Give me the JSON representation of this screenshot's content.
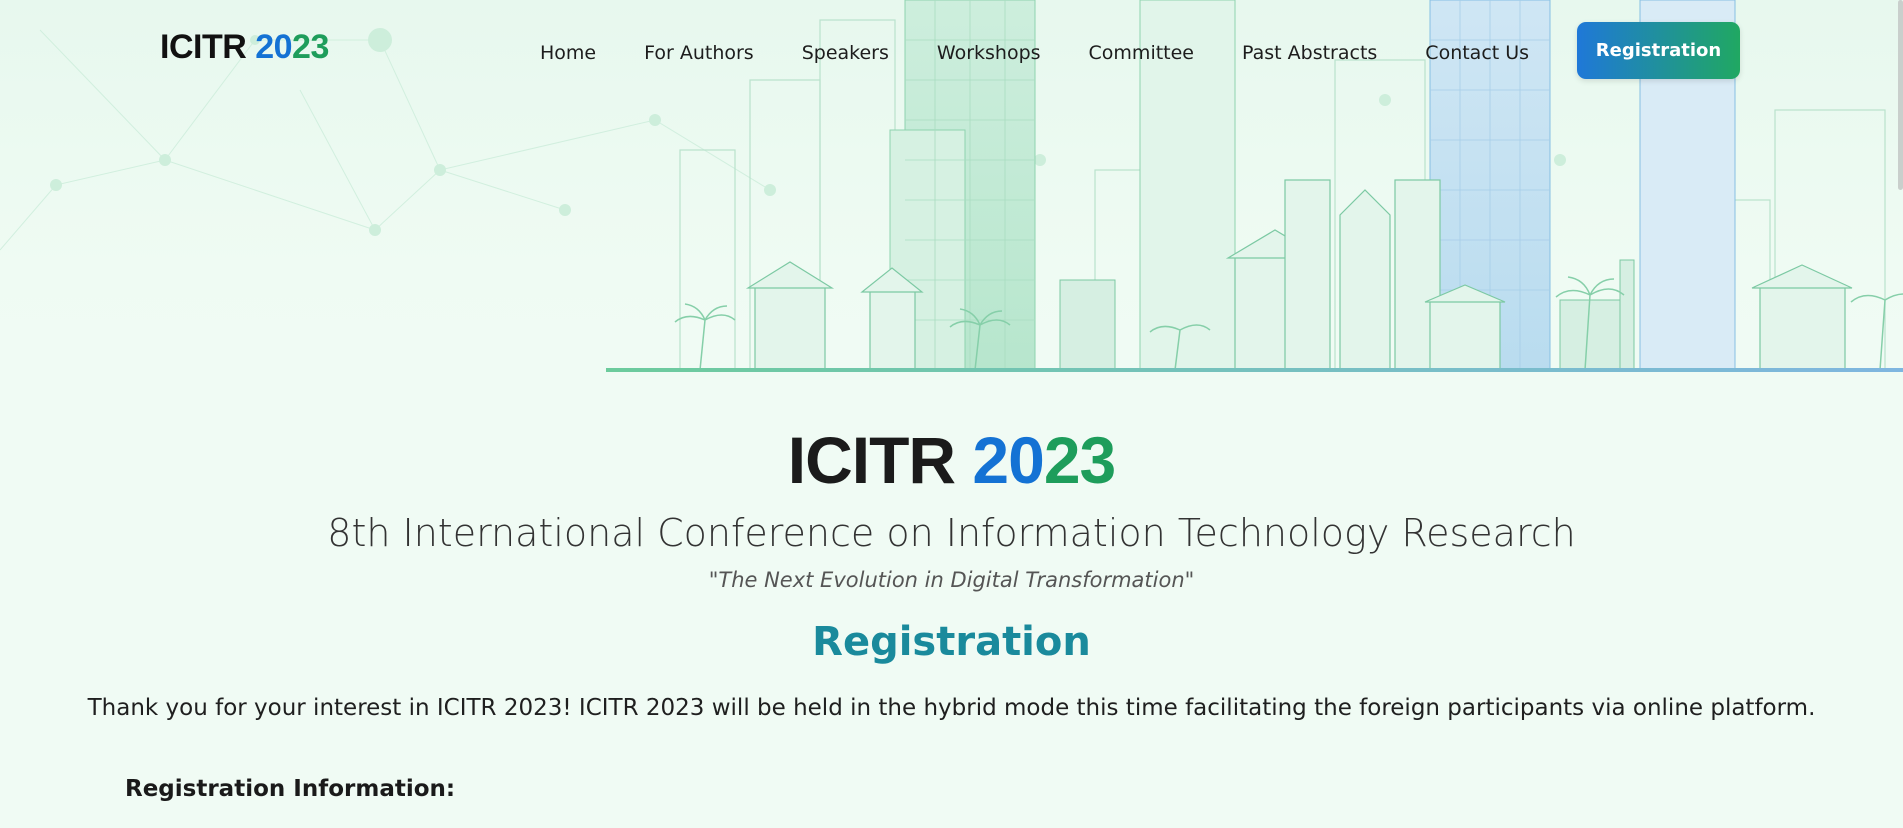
{
  "header": {
    "logo": {
      "text": "ICITR ",
      "year_a": "20",
      "year_b": "23"
    },
    "nav": [
      {
        "label": "Home"
      },
      {
        "label": "For Authors"
      },
      {
        "label": "Speakers"
      },
      {
        "label": "Workshops"
      },
      {
        "label": "Committee"
      },
      {
        "label": "Past Abstracts"
      },
      {
        "label": "Contact Us"
      }
    ],
    "cta_label": "Registration"
  },
  "hero": {
    "title_text": "ICITR ",
    "title_year_a": "20",
    "title_year_b": "23",
    "subtitle": "8th International Conference on Information Technology Research",
    "tagline": "\"The Next Evolution in Digital Transformation\""
  },
  "registration": {
    "heading": "Registration",
    "intro": "Thank you for your interest in ICITR 2023! ICITR 2023 will be held in the hybrid mode this time facilitating the foreign participants via online platform.",
    "info_heading": "Registration Information:"
  },
  "colors": {
    "blue": "#1472d4",
    "green": "#1e9d5b",
    "teal_heading": "#1a8a9c",
    "button_gradient_start": "#1f78d8",
    "button_gradient_end": "#20a862",
    "background": "#f0fbf4"
  }
}
